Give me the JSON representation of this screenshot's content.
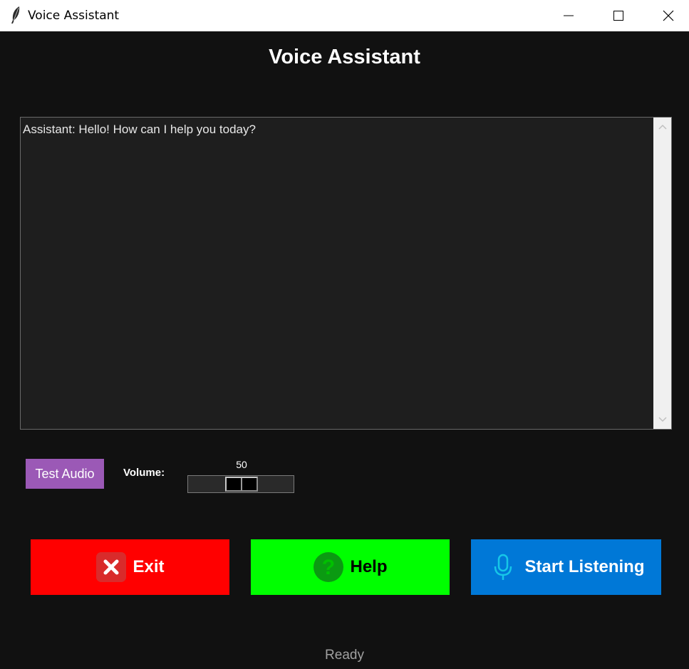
{
  "window": {
    "title": "Voice Assistant",
    "icon": "feather-icon"
  },
  "heading": "Voice Assistant",
  "chat": {
    "text": "Assistant: Hello! How can I help you today?"
  },
  "controls": {
    "test_audio_label": "Test Audio",
    "volume_label": "Volume:",
    "volume_value": "50"
  },
  "buttons": {
    "exit_label": "Exit",
    "help_label": "Help",
    "listen_label": "Start Listening"
  },
  "status": "Ready",
  "colors": {
    "exit": "#ff0000",
    "help": "#00ff00",
    "listen": "#0078d7",
    "test_audio": "#9b59b6",
    "background": "#111111"
  }
}
